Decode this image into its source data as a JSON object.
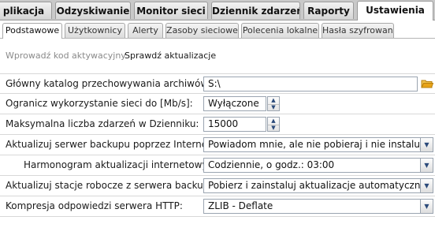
{
  "main_tabs": [
    {
      "label": "plikacja"
    },
    {
      "label": "Odzyskiwanie"
    },
    {
      "label": "Monitor sieci"
    },
    {
      "label": "Dziennik zdarzeń"
    },
    {
      "label": "Raporty"
    },
    {
      "label": "Ustawienia",
      "active": true
    }
  ],
  "sub_tabs": [
    {
      "label": "Podstawowe",
      "active": true
    },
    {
      "label": "Użytkownicy"
    },
    {
      "label": "Alerty"
    },
    {
      "label": "Zasoby sieciowe"
    },
    {
      "label": "Polecenia lokalne"
    },
    {
      "label": "Hasła szyfrowania"
    }
  ],
  "actions": {
    "activate": "Wprowadź kod aktywacyjny",
    "check_updates": "Sprawdź aktualizacje"
  },
  "settings": [
    {
      "label": "Główny katalog przechowywania archiwów:",
      "value": "S:\\",
      "control": "folder-picker"
    },
    {
      "label": "Ogranicz wykorzystanie sieci do [Mb/s]:",
      "value": "Wyłączone",
      "control": "spinner"
    },
    {
      "label": "Maksymalna liczba zdarzeń w Dzienniku:",
      "value": "15000",
      "control": "spinner"
    },
    {
      "label": "Aktualizuj serwer backupu poprzez Internet:",
      "value": "Powiadom mnie, ale nie pobieraj i nie instaluj akt",
      "control": "dropdown"
    },
    {
      "label": "Harmonogram aktualizacji internetowych:",
      "value": "Codziennie, o godz.: 03:00",
      "control": "dropdown"
    },
    {
      "label": "Aktualizuj stacje robocze z serwera backupu:",
      "value": "Pobierz i zainstaluj aktualizacje automatycznie",
      "control": "dropdown"
    },
    {
      "label": "Kompresja odpowiedzi serwera HTTP:",
      "value": "ZLIB - Deflate",
      "control": "dropdown"
    }
  ],
  "icons": {
    "spin_up": "▲",
    "spin_down": "▼",
    "dropdown": "▼",
    "folder": "folder-open-icon"
  },
  "colors": {
    "tab_bar": "#c9c9c9",
    "folder": "#e8a317",
    "row_divider": "#d8d8d8"
  }
}
